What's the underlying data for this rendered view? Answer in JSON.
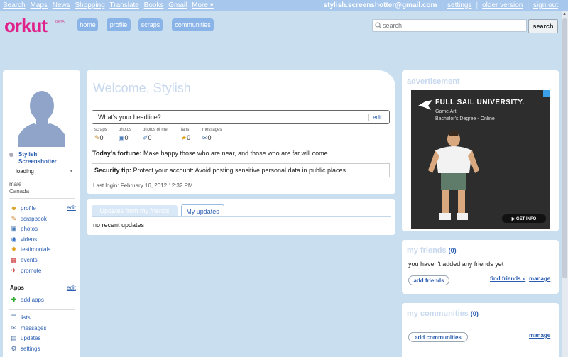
{
  "topbar": {
    "links": [
      "Search",
      "Maps",
      "News",
      "Shopping",
      "Translate",
      "Books",
      "Gmail"
    ],
    "more": "More ▾",
    "email": "stylish.screenshotter@gmail.com",
    "settings": "settings",
    "older_version": "older version",
    "sign_out": "sign out"
  },
  "header": {
    "logo": "orkut",
    "beta": "BETA",
    "nav": [
      "home",
      "profile",
      "scraps",
      "communities"
    ],
    "search_placeholder": "search",
    "search_button": "search"
  },
  "left": {
    "name": "Stylish Screenshotter",
    "status": "loading",
    "gender": "male",
    "country": "Canada",
    "edit": "edit",
    "menu": [
      "profile",
      "scrapbook",
      "photos",
      "videos",
      "testimonials",
      "events",
      "promote"
    ],
    "apps_heading": "Apps",
    "apps_edit": "edit",
    "add_apps": "add apps",
    "menu2": [
      "lists",
      "messages",
      "updates",
      "settings"
    ]
  },
  "main": {
    "welcome": "Welcome, Stylish",
    "headline_placeholder": "What's your headline?",
    "headline_edit": "edit",
    "stats": [
      {
        "label": "scraps",
        "value": "0"
      },
      {
        "label": "photos",
        "value": "0"
      },
      {
        "label": "photos of me",
        "value": "0"
      },
      {
        "label": "fans",
        "value": "0"
      },
      {
        "label": "messages",
        "value": "0"
      }
    ],
    "fortune_label": "Today's fortune:",
    "fortune_text": "Make happy those who are near, and those who are far will come",
    "tip_label": "Security tip:",
    "tip_text": "Protect your account: Avoid posting sensitive personal data in public places.",
    "last_login": "Last login: February 16, 2012 12:32 PM",
    "tab_friends": "Updates from my friends",
    "tab_mine": "My updates",
    "no_updates": "no recent updates"
  },
  "right": {
    "ad_title": "advertisement",
    "ad_univ": "FULL SAIL UNIVERSITY.",
    "ad_sub1": "Game Art",
    "ad_sub2": "Bachelor's Degree - Online",
    "ad_cta": "▶ GET INFO",
    "friends_title": "my friends",
    "friends_count": "(0)",
    "friends_empty": "you haven't added any friends yet",
    "add_friends": "add friends",
    "find_friends": "find friends »",
    "friends_manage": "manage",
    "communities_title": "my communities",
    "communities_count": "(0)",
    "add_communities": "add communities",
    "communities_manage": "manage"
  }
}
